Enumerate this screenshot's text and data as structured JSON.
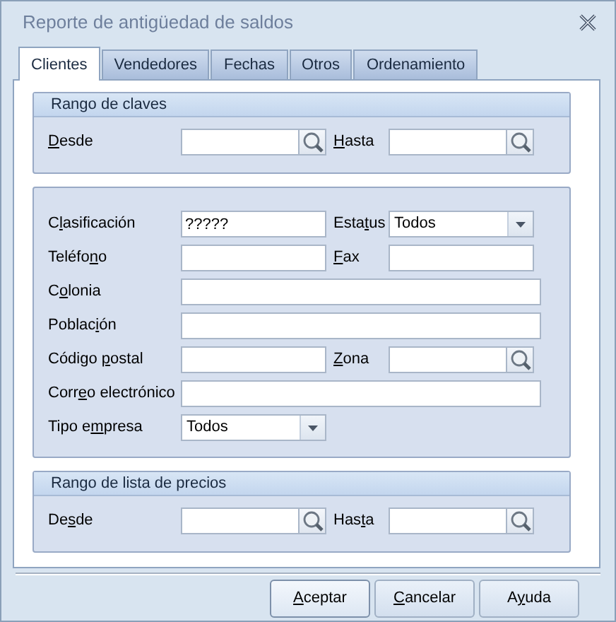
{
  "window": {
    "title": "Reporte de antigüedad de saldos"
  },
  "tabs": [
    {
      "label": "Clientes",
      "selected": true
    },
    {
      "label": "Vendedores",
      "selected": false
    },
    {
      "label": "Fechas",
      "selected": false
    },
    {
      "label": "Otros",
      "selected": false
    },
    {
      "label": "Ordenamiento",
      "selected": false
    }
  ],
  "groups": [
    {
      "title": "Rango de claves",
      "rows": [
        [
          {
            "label": {
              "key": "D",
              "after": "esde"
            },
            "kind": "lookup"
          },
          {
            "label": {
              "key": "H",
              "after": "asta"
            },
            "kind": "lookup"
          }
        ]
      ]
    },
    {
      "rows": [
        [
          {
            "label": {
              "before": "C",
              "key": "l",
              "after": "asificación"
            },
            "kind": "text",
            "value": "?????"
          },
          {
            "label": {
              "before": "Esta",
              "key": "t",
              "after": "us"
            },
            "kind": "select",
            "value": "Todos"
          }
        ],
        [
          {
            "label": {
              "before": "Teléfo",
              "key": "n",
              "after": "o"
            },
            "kind": "text"
          },
          {
            "label": {
              "key": "F",
              "after": "ax"
            },
            "kind": "text"
          }
        ],
        [
          {
            "label": {
              "before": "C",
              "key": "o",
              "after": "lonia"
            },
            "kind": "wide"
          }
        ],
        [
          {
            "label": {
              "before": "Poblac",
              "key": "i",
              "after": "ón"
            },
            "kind": "wide"
          }
        ],
        [
          {
            "label": {
              "before": "Código ",
              "key": "p",
              "after": "ostal"
            },
            "kind": "text"
          },
          {
            "label": {
              "key": "Z",
              "after": "ona"
            },
            "kind": "lookup"
          }
        ],
        [
          {
            "label": {
              "before": "Corr",
              "key": "e",
              "after": "o electrónico"
            },
            "kind": "wide"
          }
        ],
        [
          {
            "label": {
              "before": "Tipo e",
              "key": "m",
              "after": "presa"
            },
            "kind": "select",
            "value": "Todos"
          }
        ]
      ]
    },
    {
      "title": "Rango de lista de precios",
      "rows": [
        [
          {
            "label": {
              "before": "De",
              "key": "s",
              "after": "de"
            },
            "kind": "lookup"
          },
          {
            "label": {
              "before": "Has",
              "key": "t",
              "after": "a"
            },
            "kind": "lookup"
          }
        ]
      ]
    }
  ],
  "buttons": [
    {
      "key": "A",
      "after": "ceptar"
    },
    {
      "key": "C",
      "after": "ancelar"
    },
    {
      "before": "A",
      "key": "y",
      "after": "uda"
    }
  ]
}
